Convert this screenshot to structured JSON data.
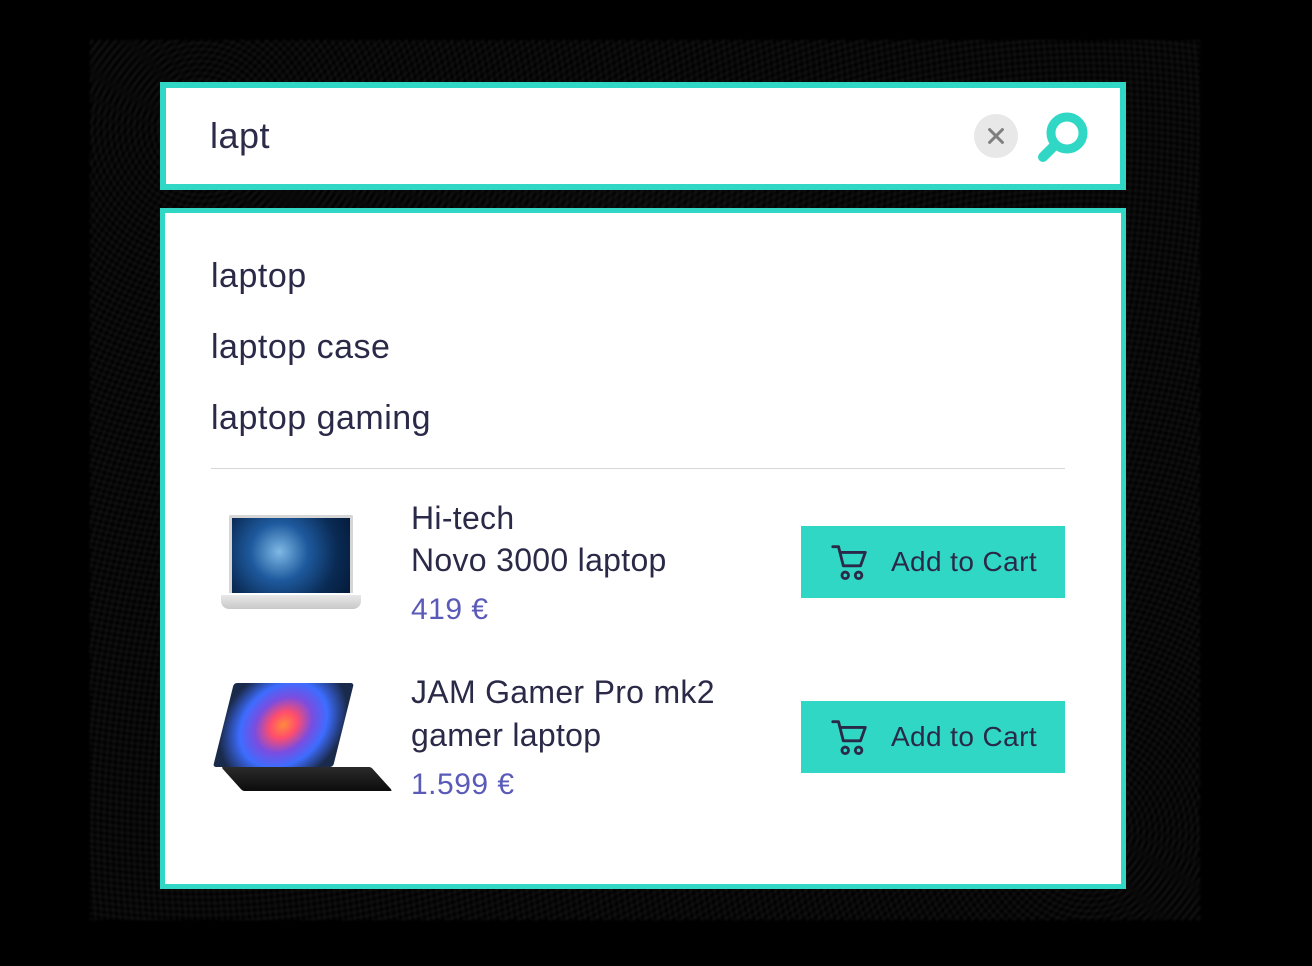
{
  "search": {
    "value": "lapt",
    "clear_icon": "close",
    "search_icon": "search"
  },
  "suggestions": [
    "laptop",
    "laptop case",
    "laptop gaming"
  ],
  "products": [
    {
      "title": "Hi-tech\nNovo 3000 laptop",
      "price": "419 €",
      "cta": "Add to Cart"
    },
    {
      "title": "JAM Gamer Pro mk2 gamer laptop",
      "price": "1.599 €",
      "cta": "Add to Cart"
    }
  ],
  "colors": {
    "accent": "#30d7c5",
    "text": "#2a2a48",
    "price": "#5a5ab8"
  }
}
